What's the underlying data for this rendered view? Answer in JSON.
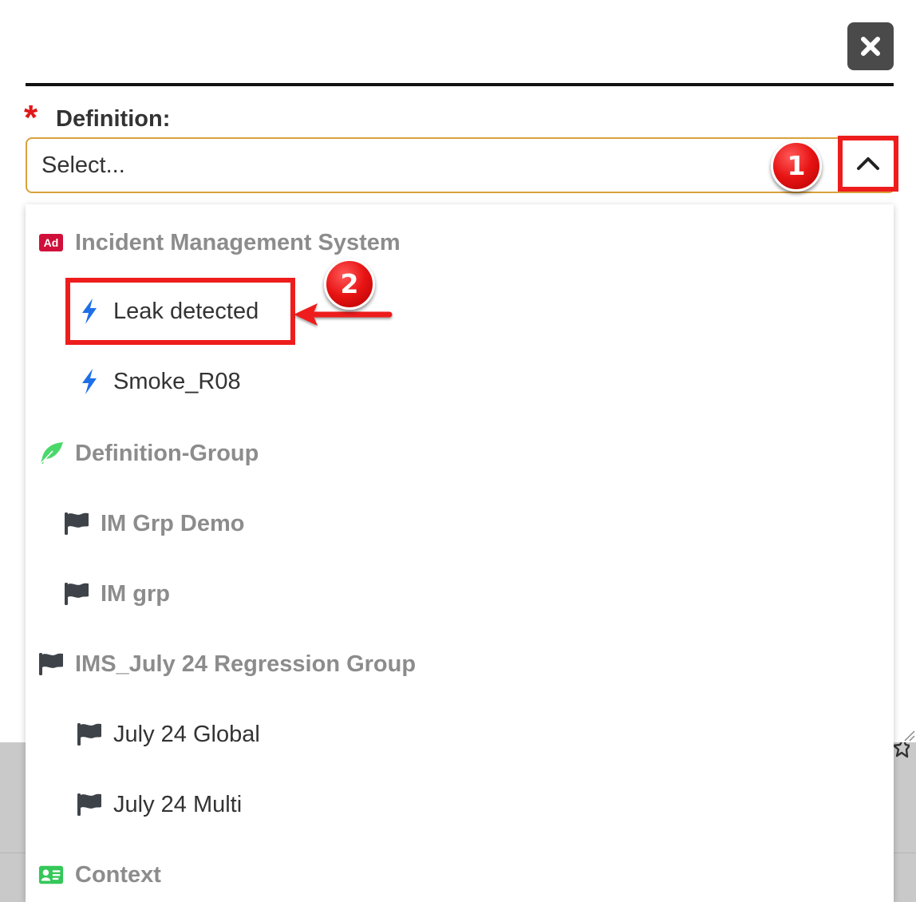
{
  "modal": {
    "close_icon": "close-icon",
    "field": {
      "required_mark": "*",
      "label": "Definition:",
      "placeholder": "Select...",
      "toggle_icon": "chevron-up-icon",
      "expanded": true
    },
    "dropdown": {
      "options": [
        {
          "kind": "group",
          "icon": "ad-icon",
          "label": "Incident Management System"
        },
        {
          "kind": "item",
          "icon": "bolt-icon",
          "label": "Leak detected"
        },
        {
          "kind": "item",
          "icon": "bolt-icon",
          "label": "Smoke_R08"
        },
        {
          "kind": "group",
          "icon": "feather-icon",
          "label": "Definition-Group"
        },
        {
          "kind": "subgroup",
          "icon": "flag-icon",
          "label": "IM Grp Demo"
        },
        {
          "kind": "subgroup",
          "icon": "flag-icon",
          "label": "IM grp"
        },
        {
          "kind": "group",
          "icon": "flag-icon",
          "label": "IMS_July 24 Regression Group"
        },
        {
          "kind": "item",
          "icon": "flag-icon",
          "label": "July 24 Global"
        },
        {
          "kind": "item",
          "icon": "flag-icon",
          "label": "July 24 Multi"
        },
        {
          "kind": "group",
          "icon": "contact-card-icon",
          "label": "Context"
        }
      ]
    }
  },
  "annotations": {
    "step_1": "1",
    "step_2": "2"
  },
  "colors": {
    "required": "#e01818",
    "select_border": "#d9a23c",
    "annotation_red": "#ee1d1d",
    "bolt_blue": "#1f6fe8",
    "ad_red": "#d0103a",
    "feather_green": "#4bd86a",
    "contact_green": "#35c759",
    "flag_dark": "#3e4349"
  }
}
